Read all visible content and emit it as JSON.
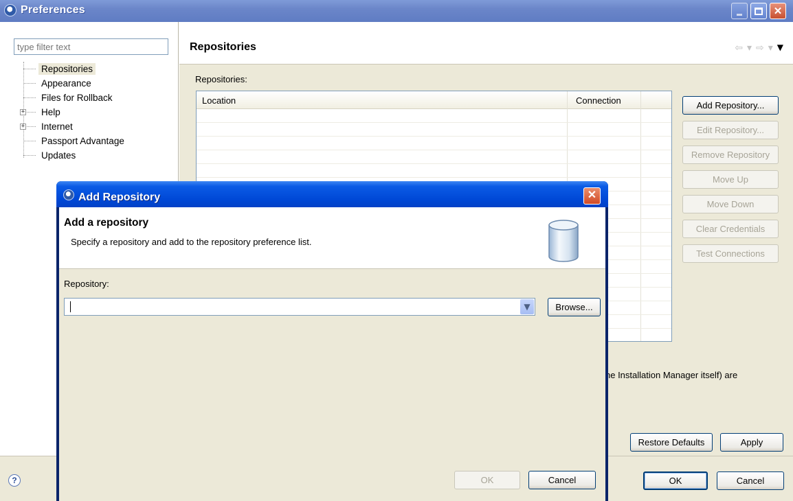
{
  "window": {
    "title": "Preferences"
  },
  "nav": {
    "filter_placeholder": "type filter text",
    "items": [
      {
        "label": "Repositories",
        "selected": true,
        "expandable": false
      },
      {
        "label": "Appearance",
        "selected": false,
        "expandable": false
      },
      {
        "label": "Files for Rollback",
        "selected": false,
        "expandable": false
      },
      {
        "label": "Help",
        "selected": false,
        "expandable": true
      },
      {
        "label": "Internet",
        "selected": false,
        "expandable": true
      },
      {
        "label": "Passport Advantage",
        "selected": false,
        "expandable": false
      },
      {
        "label": "Updates",
        "selected": false,
        "expandable": false
      }
    ]
  },
  "page": {
    "title": "Repositories",
    "section_label": "Repositories:",
    "table": {
      "columns": [
        "Location",
        "Connection"
      ],
      "rows": []
    },
    "buttons": {
      "add": "Add Repository...",
      "edit": "Edit Repository...",
      "remove": "Remove Repository",
      "move_up": "Move Up",
      "move_down": "Move Down",
      "clear_credentials": "Clear Credentials",
      "test_connections": "Test Connections"
    },
    "info_text_visible": "he Installation Manager itself) are",
    "restore_defaults": "Restore Defaults",
    "apply": "Apply"
  },
  "footer": {
    "ok": "OK",
    "cancel": "Cancel",
    "help_glyph": "?"
  },
  "dialog": {
    "title": "Add Repository",
    "heading": "Add a repository",
    "description": "Specify a repository and add to the repository preference list.",
    "field_label": "Repository:",
    "field_value": "",
    "browse": "Browse...",
    "ok": "OK",
    "cancel": "Cancel",
    "close_glyph": "✕"
  },
  "colors": {
    "accent": "#0a246a",
    "dialog_title": "#0048d6",
    "window_bg": "#ece9d8"
  }
}
